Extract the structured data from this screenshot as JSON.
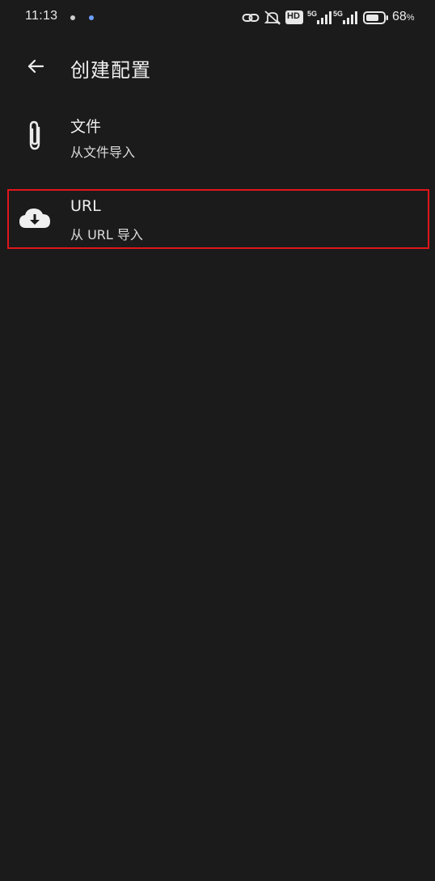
{
  "status_bar": {
    "time": "11:13",
    "battery_percent": "68",
    "battery_percent_sign": "%",
    "network_labels": [
      "5G",
      "5G"
    ],
    "hd_label": "HD"
  },
  "app_bar": {
    "title": "创建配置",
    "back_icon": "arrow-left-icon"
  },
  "items": [
    {
      "icon": "paperclip-icon",
      "title": "文件",
      "subtitle": "从文件导入"
    },
    {
      "icon": "cloud-download-icon",
      "title": "URL",
      "subtitle": "从 URL 导入",
      "highlighted": true,
      "highlight_color": "#e0161b"
    }
  ],
  "colors": {
    "background": "#1b1b1b",
    "text_primary": "#efefef",
    "accent_dot": "#6aa0ff"
  }
}
